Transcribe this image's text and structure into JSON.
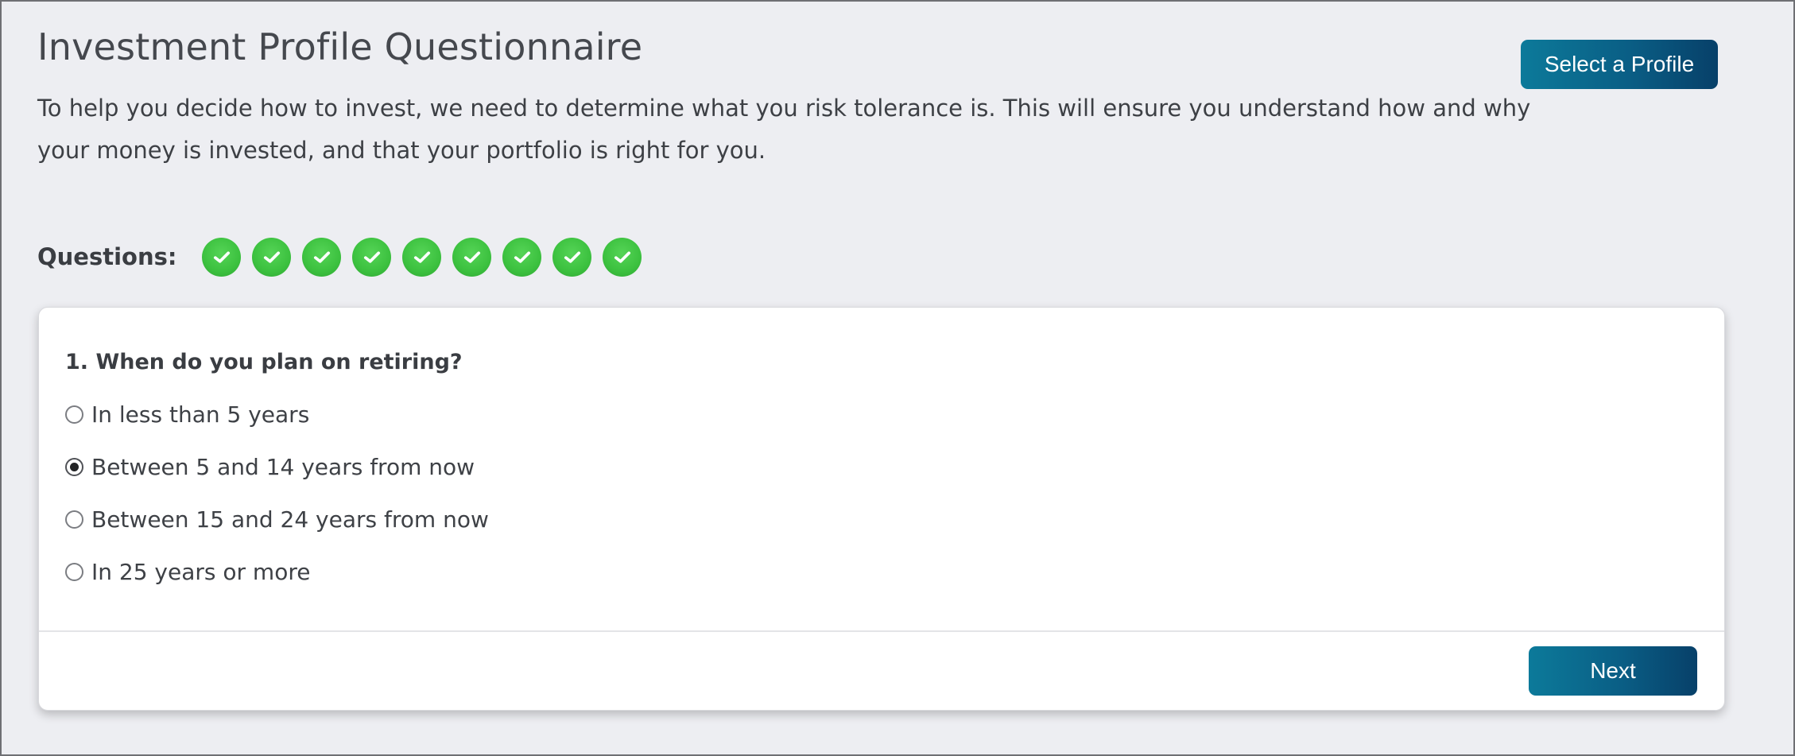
{
  "header": {
    "title": "Investment Profile Questionnaire",
    "intro": "To help you decide how to invest, we need to determine what you risk tolerance is. This will ensure you understand how and why your money is invested, and that your portfolio is right for you.",
    "select_profile_label": "Select a Profile"
  },
  "progress": {
    "label": "Questions:",
    "total": 9,
    "completed": 9,
    "icon": "checkmark-icon",
    "color": "#3cc13f"
  },
  "question": {
    "text": "1. When do you plan on retiring?",
    "options": [
      {
        "label": "In less than 5 years",
        "selected": false
      },
      {
        "label": "Between 5 and 14 years from now",
        "selected": true
      },
      {
        "label": "Between 15 and 24 years from now",
        "selected": false
      },
      {
        "label": "In 25 years or more",
        "selected": false
      }
    ]
  },
  "footer": {
    "next_label": "Next"
  },
  "colors": {
    "accent_start": "#0c7a9a",
    "accent_end": "#074069",
    "background": "#edeef2"
  }
}
